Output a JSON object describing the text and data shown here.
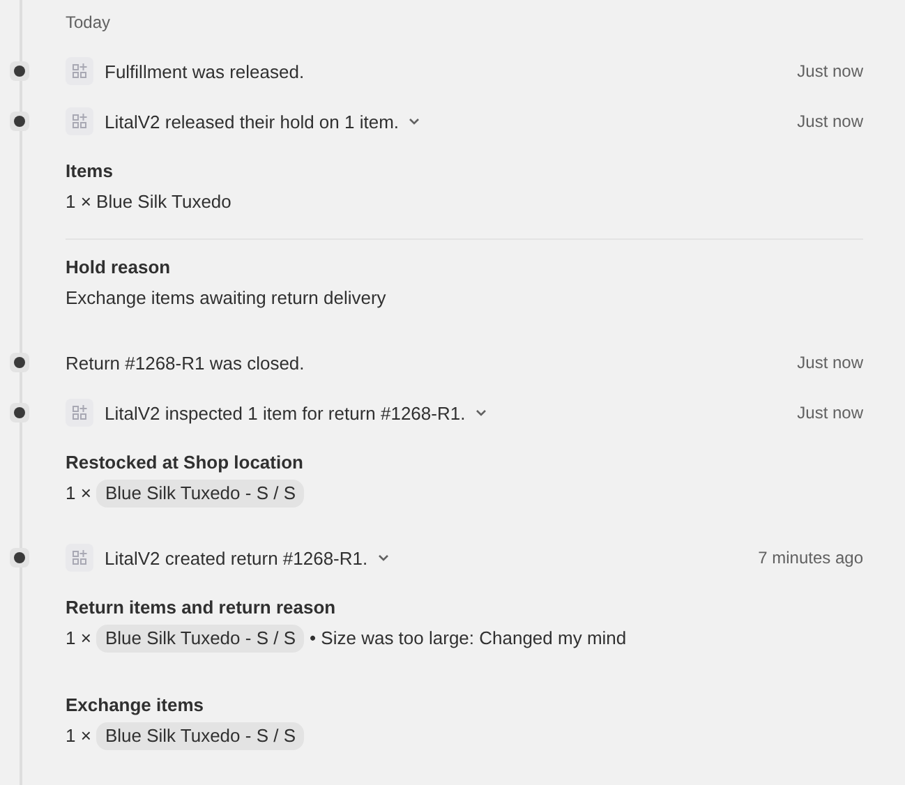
{
  "date_heading": "Today",
  "events": [
    {
      "text": "Fulfillment was released.",
      "time": "Just now",
      "has_icon": true,
      "expandable": false
    },
    {
      "text": "LitalV2 released their hold on 1 item.",
      "time": "Just now",
      "has_icon": true,
      "expandable": true,
      "sections": [
        {
          "title": "Items",
          "lines": [
            {
              "kind": "plain",
              "text": "1 × Blue Silk Tuxedo"
            }
          ]
        },
        {
          "title": "Hold reason",
          "divider_before": true,
          "lines": [
            {
              "kind": "plain",
              "text": "Exchange items awaiting return delivery"
            }
          ]
        }
      ]
    },
    {
      "text": "Return #1268-R1 was closed.",
      "time": "Just now",
      "has_icon": false,
      "expandable": false
    },
    {
      "text": "LitalV2 inspected 1 item for return #1268-R1.",
      "time": "Just now",
      "has_icon": true,
      "expandable": true,
      "sections": [
        {
          "title": "Restocked at Shop location",
          "lines": [
            {
              "kind": "item",
              "qty": "1 ×",
              "tag": "Blue Silk Tuxedo - S / S"
            }
          ]
        }
      ]
    },
    {
      "text": "LitalV2 created return #1268-R1.",
      "time": "7 minutes ago",
      "has_icon": true,
      "expandable": true,
      "sections": [
        {
          "title": "Return items and return reason",
          "lines": [
            {
              "kind": "item",
              "qty": "1 ×",
              "tag": "Blue Silk Tuxedo - S / S",
              "note": "• Size was too large: Changed my mind"
            }
          ]
        },
        {
          "title": "Exchange items",
          "lines": [
            {
              "kind": "item",
              "qty": "1 ×",
              "tag": "Blue Silk Tuxedo - S / S"
            }
          ]
        }
      ]
    }
  ]
}
